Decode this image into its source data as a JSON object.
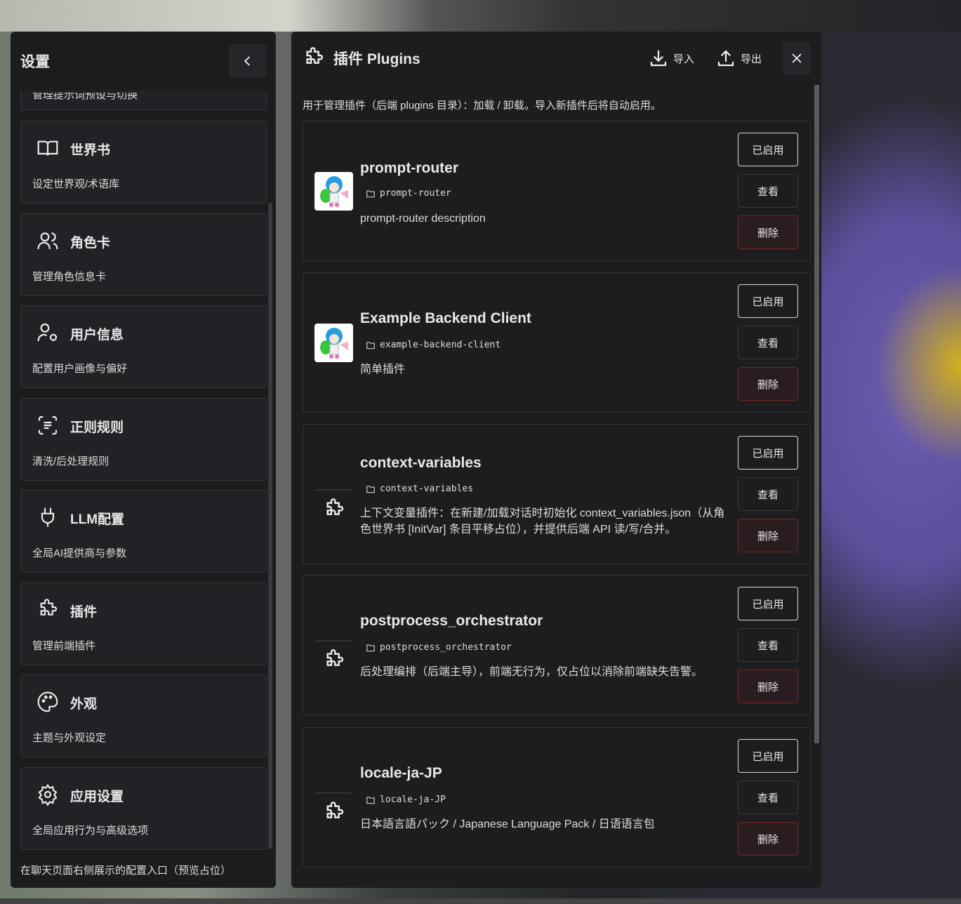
{
  "settings": {
    "title": "设置",
    "partial_item_desc": "管理提示词预设与切换",
    "items": [
      {
        "title": "世界书",
        "desc": "设定世界观/术语库",
        "icon": "book-icon"
      },
      {
        "title": "角色卡",
        "desc": "管理角色信息卡",
        "icon": "users-icon"
      },
      {
        "title": "用户信息",
        "desc": "配置用户画像与偏好",
        "icon": "user-gear-icon"
      },
      {
        "title": "正则规则",
        "desc": "清洗/后处理规则",
        "icon": "regex-icon"
      },
      {
        "title": "LLM配置",
        "desc": "全局AI提供商与参数",
        "icon": "plug-icon"
      },
      {
        "title": "插件",
        "desc": "管理前端插件",
        "icon": "puzzle-icon"
      },
      {
        "title": "外观",
        "desc": "主题与外观设定",
        "icon": "palette-icon"
      },
      {
        "title": "应用设置",
        "desc": "全局应用行为与高级选项",
        "icon": "gear-icon"
      }
    ],
    "footer": "在聊天页面右侧展示的配置入口（预览占位）"
  },
  "plugins": {
    "title": "插件 Plugins",
    "import": "导入",
    "export": "导出",
    "intro": "用于管理插件（后端 plugins 目录）：加载 / 卸载。导入新插件后将自动启用。",
    "buttons": {
      "enabled": "已启用",
      "view": "查看",
      "delete": "删除"
    },
    "list": [
      {
        "name": "prompt-router",
        "dir": "prompt-router",
        "desc": "prompt-router description",
        "avatar": "image"
      },
      {
        "name": "Example Backend Client",
        "dir": "example-backend-client",
        "desc": "简单插件",
        "avatar": "image"
      },
      {
        "name": "context-variables",
        "dir": "context-variables",
        "desc": "上下文变量插件：在新建/加载对话时初始化 context_variables.json（从角色世界书 [InitVar] 条目平移占位），并提供后端 API 读/写/合并。",
        "avatar": "puzzle"
      },
      {
        "name": "postprocess_orchestrator",
        "dir": "postprocess_orchestrator",
        "desc": "后处理编排（后端主导），前端无行为，仅占位以消除前端缺失告警。",
        "avatar": "puzzle"
      },
      {
        "name": "locale-ja-JP",
        "dir": "locale-ja-JP",
        "desc": "日本語言語パック / Japanese Language Pack / 日语语言包",
        "avatar": "puzzle"
      }
    ]
  }
}
